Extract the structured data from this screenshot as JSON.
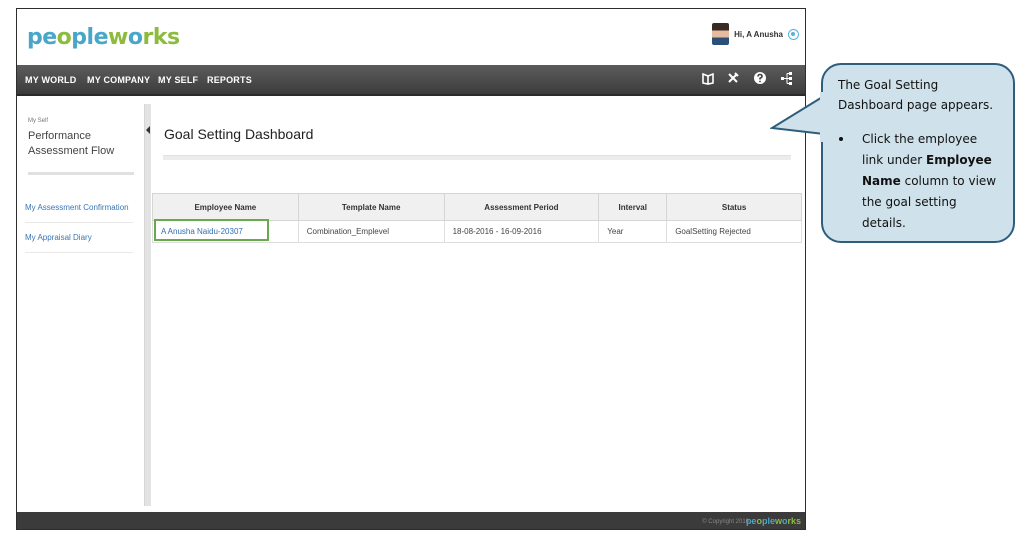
{
  "app": {
    "logo_part1": "pe",
    "logo_part2": "o",
    "logo_part3": "ple",
    "logo_part4": "w",
    "logo_part5": "o",
    "logo_part6": "rks",
    "greeting": "Hi, A Anusha"
  },
  "nav": {
    "items": [
      "MY WORLD",
      "MY COMPANY",
      "MY SELF",
      "REPORTS"
    ]
  },
  "sidebar": {
    "breadcrumb": "My Self",
    "title": "Performance Assessment Flow",
    "links": [
      "My Assessment Confirmation",
      "My Appraisal Diary"
    ]
  },
  "main": {
    "title": "Goal Setting Dashboard",
    "table": {
      "columns": [
        "Employee Name",
        "Template Name",
        "Assessment Period",
        "Interval",
        "Status"
      ],
      "rows": [
        [
          "A Anusha Naidu-20307",
          "Combination_Emplevel",
          "18-08-2016 - 16-09-2016",
          "Year",
          "GoalSetting Rejected"
        ]
      ]
    }
  },
  "footer": {
    "copyright": "© Copyright 2016",
    "logo_part1": "pe",
    "logo_part2": "o",
    "logo_part3": "ple",
    "logo_part4": "w",
    "logo_part5": "o",
    "logo_part6": "rks"
  },
  "callout": {
    "intro": "The Goal Setting Dashboard page appears.",
    "bullet_pre": "Click the employee link under ",
    "bullet_bold": "Employee Name",
    "bullet_post": " column to view the goal setting details."
  },
  "colors": {
    "brand_blue": "#4aa6c8",
    "brand_green": "#8dbb3e",
    "navbar": "#4a4a4a",
    "highlight": "#6aa84f",
    "callout_fill": "#cfe1eb",
    "callout_border": "#2f5d7c",
    "link": "#2f6fb6"
  },
  "icons": [
    "settings-gear-icon",
    "book-icon",
    "tools-icon",
    "help-icon",
    "sitemap-icon",
    "collapse-arrow-icon"
  ]
}
